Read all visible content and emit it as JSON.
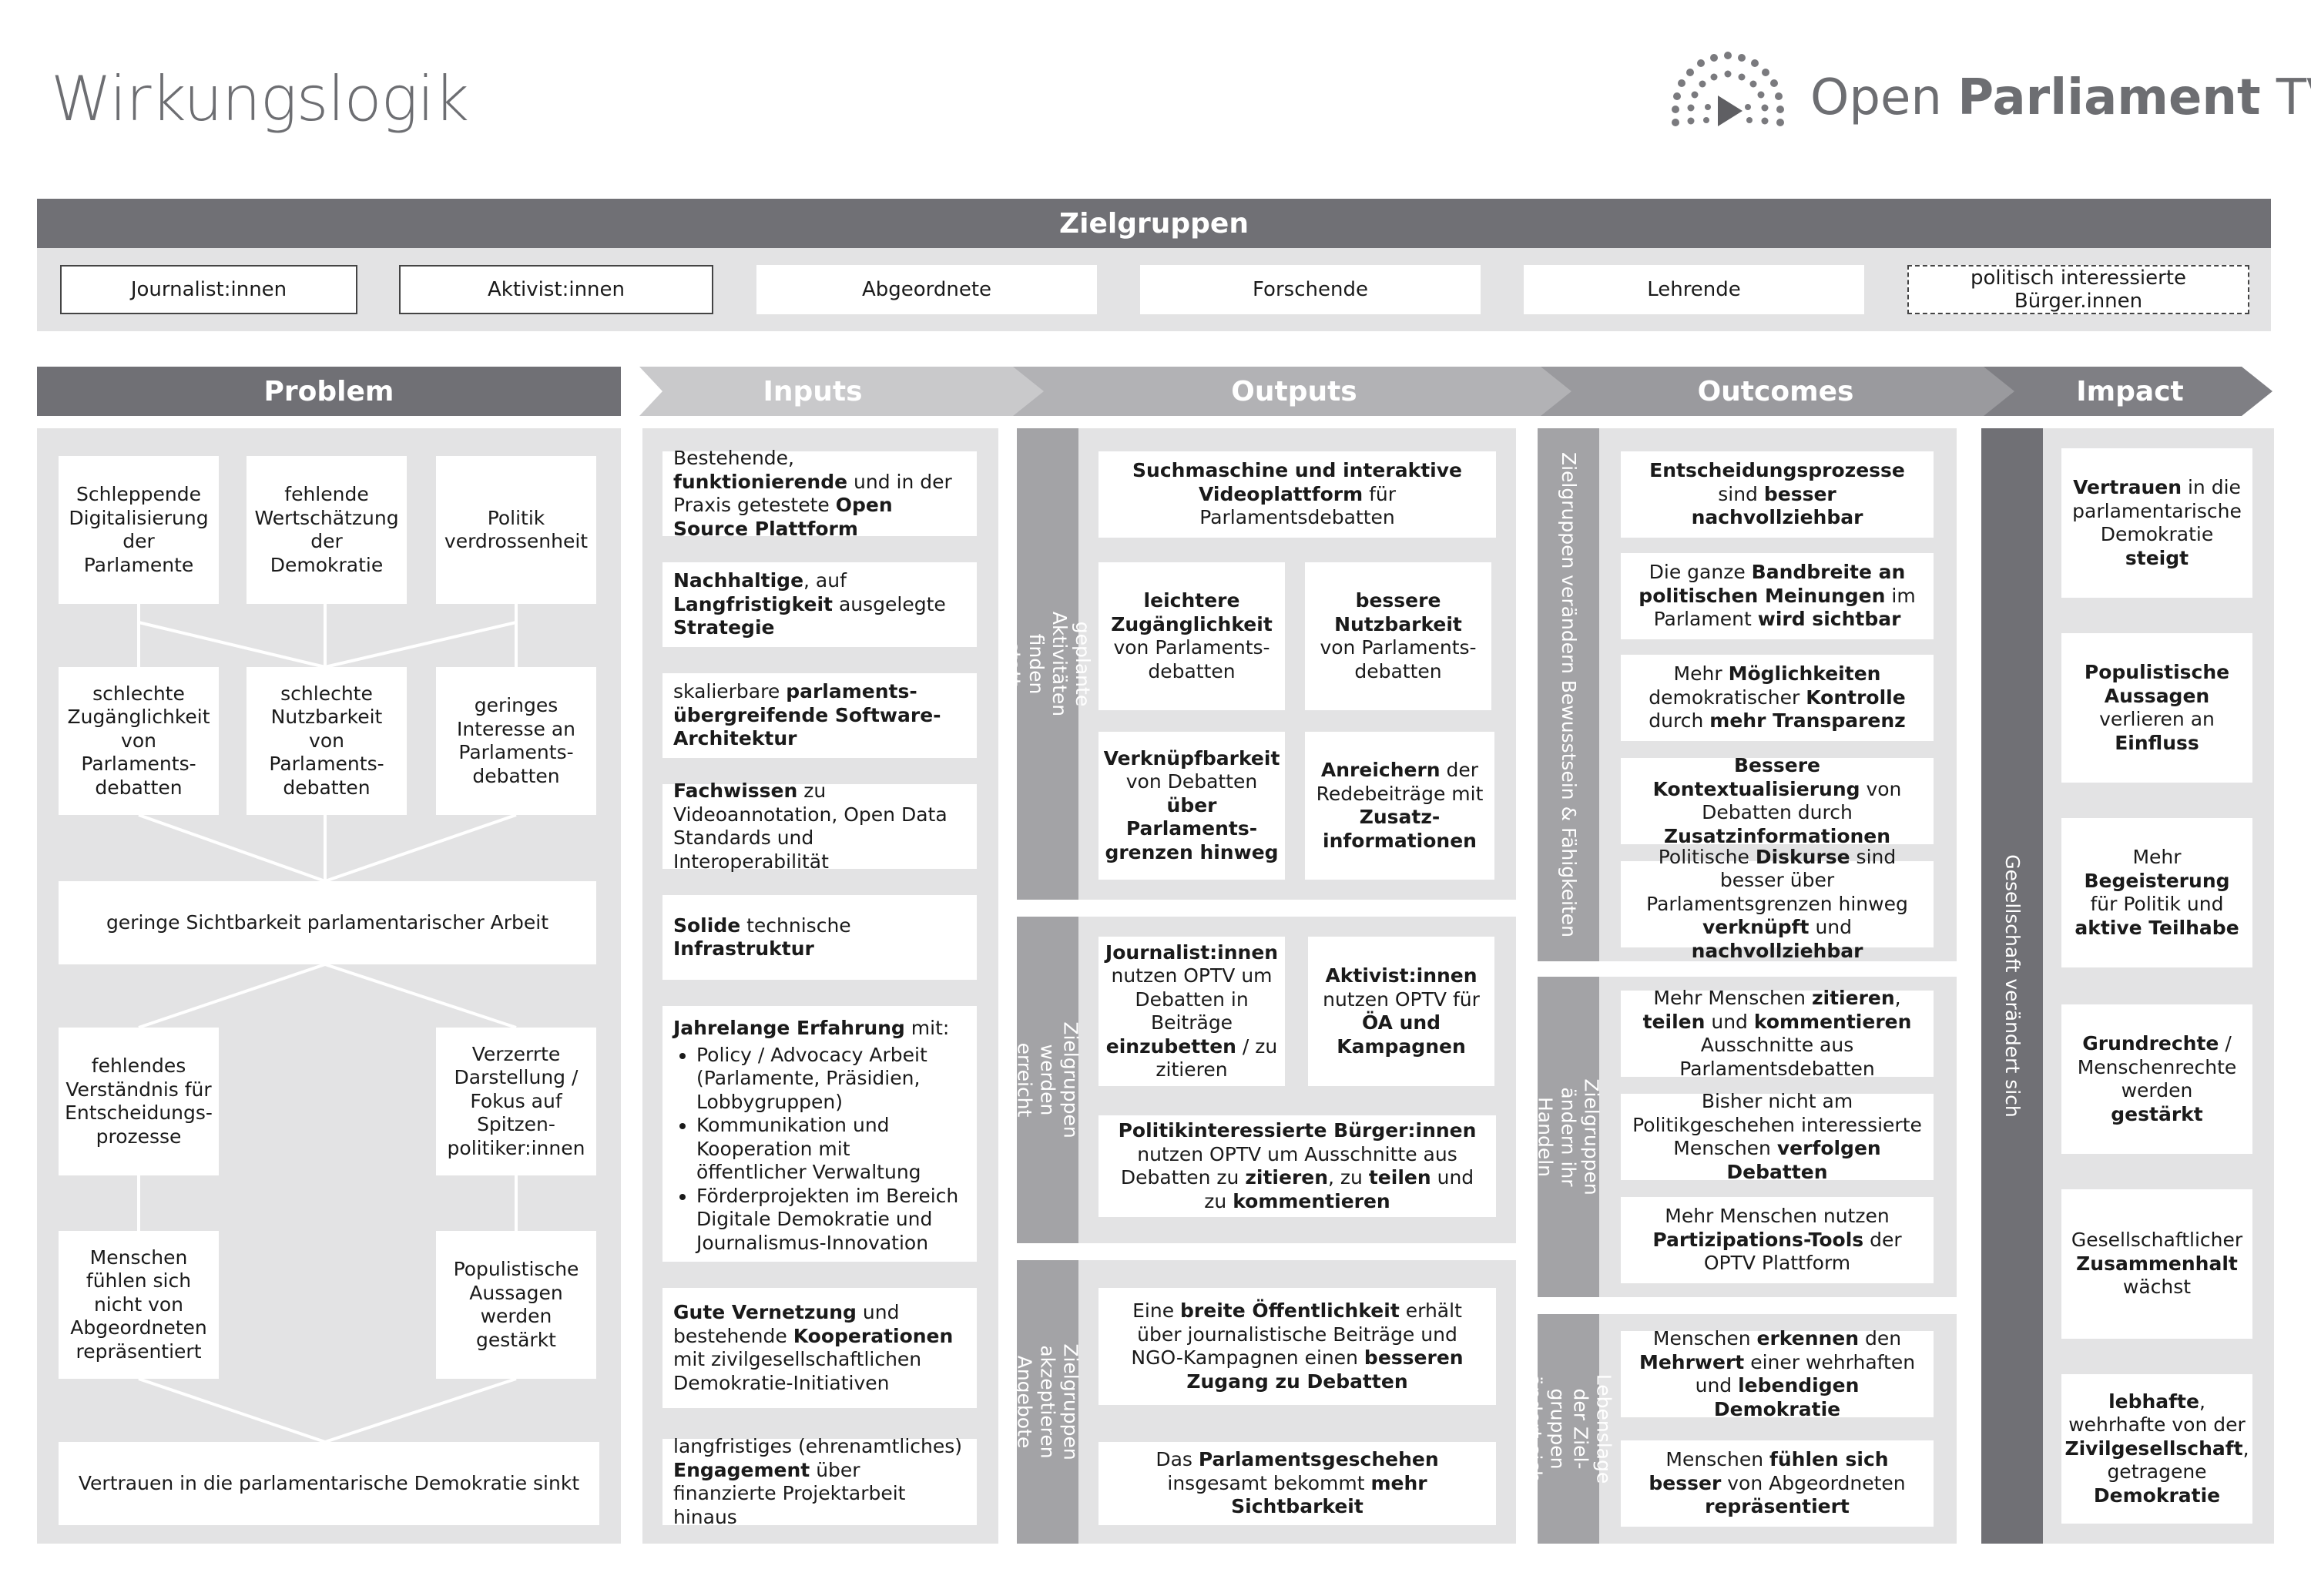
{
  "page": {
    "title": "Wirkungslogik"
  },
  "logo": {
    "text_light": "Open ",
    "text_bold": "Parliament",
    "text_end": " TV"
  },
  "zielgruppen": {
    "header": "Zielgruppen",
    "items": [
      "Journalist:innen",
      "Aktivist:innen",
      "Abgeordnete",
      "Forschende",
      "Lehrende",
      "politisch interessierte Bürger.innen"
    ]
  },
  "columns": {
    "problem": "Problem",
    "inputs": "Inputs",
    "outputs": "Outputs",
    "outcomes": "Outcomes",
    "impact": "Impact"
  },
  "problem": {
    "row1": [
      "Schleppende Digitalisierung der Parlamente",
      "fehlende Wertschätzung der Demokratie",
      "Politik verdrossenheit"
    ],
    "row2": [
      "schlechte Zugänglichkeit von Parlaments-debatten",
      "schlechte Nutzbarkeit von Parlaments-debatten",
      "geringes Interesse an Parlaments-debatten"
    ],
    "center1": "geringe Sichtbarkeit parlamentarischer Arbeit",
    "row3": [
      "fehlendes Verständnis für Entscheidungs-prozesse",
      "Verzerrte Darstellung / Fokus auf Spitzen-politiker:innen"
    ],
    "row4": [
      "Menschen fühlen sich nicht von Abgeordneten repräsentiert",
      "Populistische Aussagen werden gestärkt"
    ],
    "center2": "Vertrauen in die parlamentarische Demokratie sinkt"
  },
  "inputs": {
    "i1": [
      "Bestehende, ",
      "funktionierende",
      " und in der Praxis getestete ",
      "Open Source Plattform"
    ],
    "i2": [
      "Nachhaltige",
      ", auf ",
      "Langfristigkeit",
      " ausgelegte ",
      "Strategie"
    ],
    "i3": [
      "skalierbare ",
      "parlaments-übergreifende Software-Architektur"
    ],
    "i4": [
      "Fachwissen",
      " zu Videoannotation, Open Data Standards und Interoperabilität"
    ],
    "i5": [
      "Solide",
      " technische ",
      "Infrastruktur"
    ],
    "i6_head": [
      "Jahrelange Erfahrung",
      " mit:"
    ],
    "i6_list": [
      "Policy / Advocacy Arbeit (Parlamente, Präsidien, Lobbygruppen)",
      "Kommunikation und Kooperation mit öffentlicher Verwaltung",
      "Förderprojekten im Bereich Digitale Demokratie und Journalismus-Innovation"
    ],
    "i7": [
      "Gute Vernetzung",
      " und bestehende ",
      "Kooperationen",
      " mit zivilgesellschaftlichen Demokratie-Initiativen"
    ],
    "i8": [
      "langfristiges",
      " (ehrenamtliches) ",
      "Engagement",
      " über finanzierte Projektarbeit hinaus"
    ]
  },
  "outputs": {
    "label1": "geplante Aktivitäten finden statt",
    "label2": "Zielgruppen werden erreicht",
    "label3": "Zielgruppen akzeptieren Angebote",
    "o1": [
      "Suchmaschine und interaktive Videoplattform",
      " für Parlamentsdebatten"
    ],
    "o2": [
      "leichtere Zugänglichkeit",
      " von Parlaments-debatten"
    ],
    "o3": [
      "bessere Nutzbarkeit",
      " von Parlaments-debatten"
    ],
    "o4": [
      "Verknüpfbarkeit",
      " von Debatten ",
      "über Parlaments-grenzen hinweg"
    ],
    "o5": [
      "Anreichern",
      " der Redebeiträge mit ",
      "Zusatz-informationen"
    ],
    "o6": [
      "Journalist:innen",
      " nutzen OPTV um Debatten in Beiträge ",
      "einzubetten",
      " / zu zitieren"
    ],
    "o7": [
      "Aktivist:innen",
      " nutzen OPTV für ",
      "ÖA und Kampagnen"
    ],
    "o8": [
      "Politikinteressierte Bürger:innen",
      " nutzen OPTV um Ausschnitte aus Debatten zu ",
      "zitieren",
      ", zu ",
      "teilen",
      " und zu ",
      "kommentieren"
    ],
    "o9": [
      "Eine ",
      "breite Öffentlichkeit",
      " erhält über journalistische Beiträge und NGO-Kampagnen einen ",
      "besseren Zugang zu Debatten"
    ],
    "o10": [
      "Das ",
      "Parlamentsgeschehen",
      " insgesamt bekommt ",
      "mehr Sichtbarkeit"
    ]
  },
  "outcomes": {
    "label1": "Zielgruppen verändern Bewusstsein & Fähigkeiten",
    "label2": "Zielgruppen ändern ihr Handeln",
    "label3": "Lebenslage der Ziel-gruppen ändert sich",
    "c1": [
      "Entscheidungsprozesse",
      " sind ",
      "besser nachvollziehbar"
    ],
    "c2": [
      "Die ganze ",
      "Bandbreite an politischen Meinungen",
      " im Parlament ",
      "wird sichtbar"
    ],
    "c3": [
      "Mehr ",
      "Möglichkeiten",
      " demokratischer ",
      "Kontrolle",
      " durch ",
      "mehr Transparenz"
    ],
    "c4": [
      "Bessere Kontextualisierung",
      " von Debatten durch ",
      "Zusatzinformationen"
    ],
    "c5": [
      "Politische ",
      "Diskurse",
      " sind besser über Parlamentsgrenzen hinweg ",
      "verknüpft",
      " und ",
      "nachvollziehbar"
    ],
    "c6": [
      "Mehr Menschen ",
      "zitieren",
      ", ",
      "teilen",
      " und ",
      "kommentieren",
      " Ausschnitte aus Parlamentsdebatten"
    ],
    "c7": [
      "Bisher nicht am Politikgeschehen interessierte Menschen ",
      "verfolgen Debatten"
    ],
    "c8": [
      "Mehr Menschen nutzen ",
      "Partizipations-Tools",
      " der OPTV Plattform"
    ],
    "c9": [
      "Menschen ",
      "erkennen",
      " den ",
      "Mehrwert",
      " einer wehrhaften und ",
      "lebendigen Demokratie"
    ],
    "c10": [
      "Menschen ",
      "fühlen sich besser",
      " von Abgeordneten ",
      "repräsentiert"
    ]
  },
  "impact": {
    "label": "Gesellschaft verändert sich",
    "m1": [
      "Vertrauen",
      " in die parlamentarische Demokratie ",
      "steigt"
    ],
    "m2": [
      "Populistische Aussagen",
      " verlieren an ",
      "Einfluss"
    ],
    "m3": [
      "Mehr ",
      "Begeisterung",
      " für Politik und ",
      "aktive Teilhabe"
    ],
    "m4": [
      "Grundrechte",
      " / Menschenrechte werden ",
      "gestärkt"
    ],
    "m5": [
      "Gesellschaftlicher ",
      "Zusammenhalt",
      " wächst"
    ],
    "m6": [
      "lebhafte",
      ", wehrhafte von der ",
      "Zivilgesellschaft",
      ", getragene ",
      "Demokratie"
    ]
  },
  "colors": {
    "dark_gray": "#707075",
    "mid_gray": "#a3a3a6",
    "panel": "#e3e3e4"
  }
}
